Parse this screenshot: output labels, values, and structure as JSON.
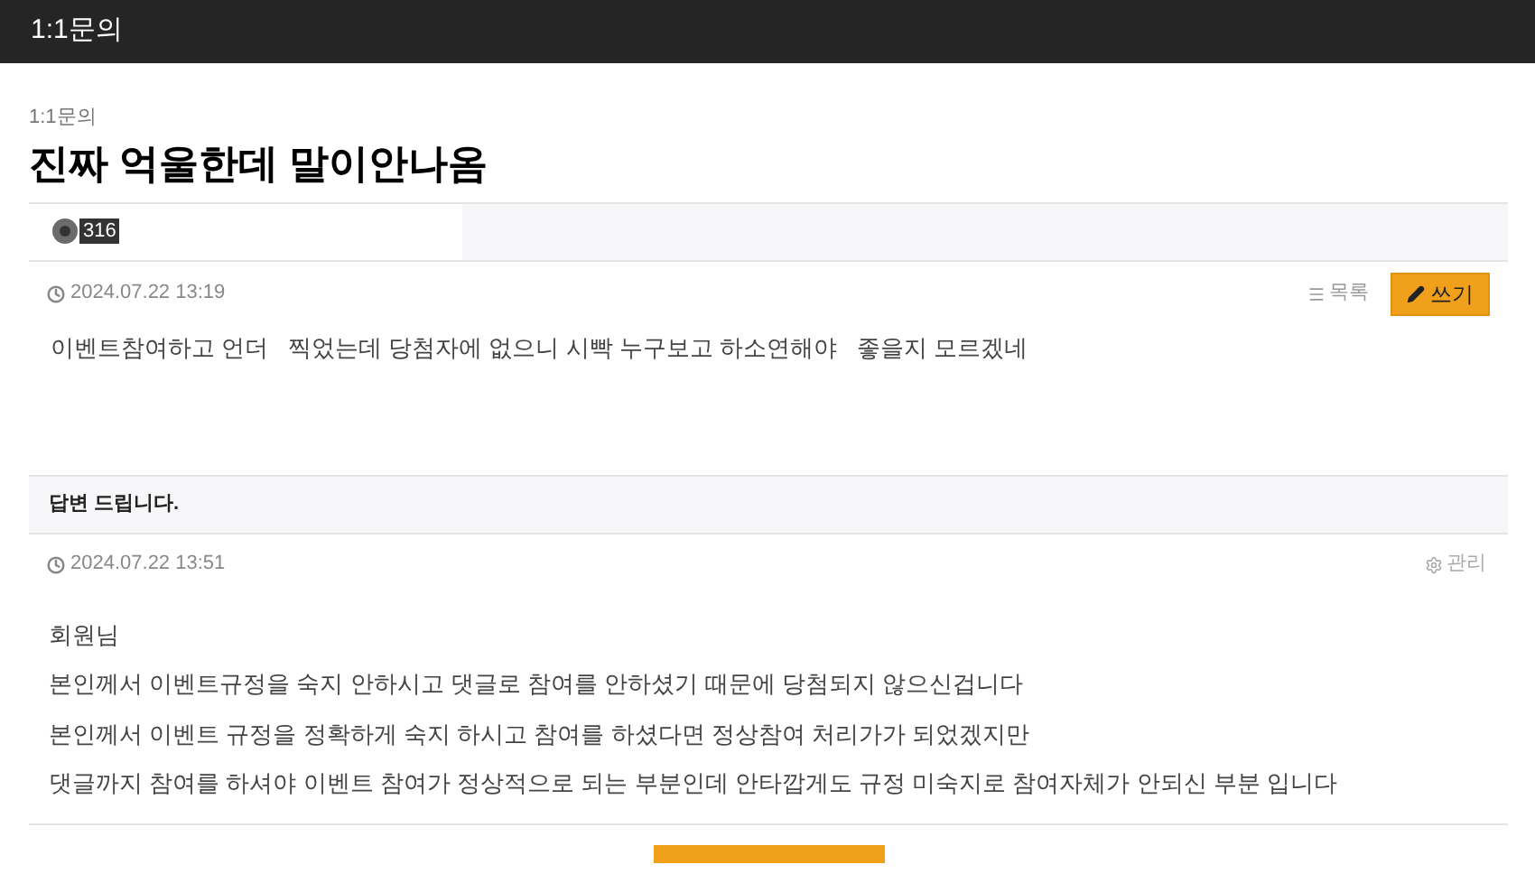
{
  "header": {
    "title": "1:1문의"
  },
  "breadcrumb": "1:1문의",
  "post": {
    "title": "진짜 억울한데 말이안나옴",
    "author": {
      "level": "316"
    },
    "date": "2024.07.22  13:19",
    "actions": [
      {
        "kind": "list",
        "label": "목록"
      },
      {
        "kind": "write",
        "label": "쓰기"
      }
    ],
    "body": "이벤트참여하고 언더   찍었는데 당첨자에 없으니 시빡 누구보고 하소연해야   좋을지 모르겠네"
  },
  "answer": {
    "heading": "답변 드립니다.",
    "date": "2024.07.22  13:51",
    "manage": "관리",
    "lines": [
      "회원님",
      "본인께서 이벤트규정을 숙지 안하시고 댓글로 참여를 안하셨기 때문에 당첨되지 않으신겁니다",
      "본인께서 이벤트 규정을 정확하게 숙지 하시고 참여를 하셨다면 정상참여 처리가가 되었겠지만",
      "댓글까지 참여를 하셔야 이벤트 참여가 정상적으로 되는 부분인데 안타깝게도 규정 미숙지로 참여자체가 안되신 부분 입니다"
    ]
  }
}
